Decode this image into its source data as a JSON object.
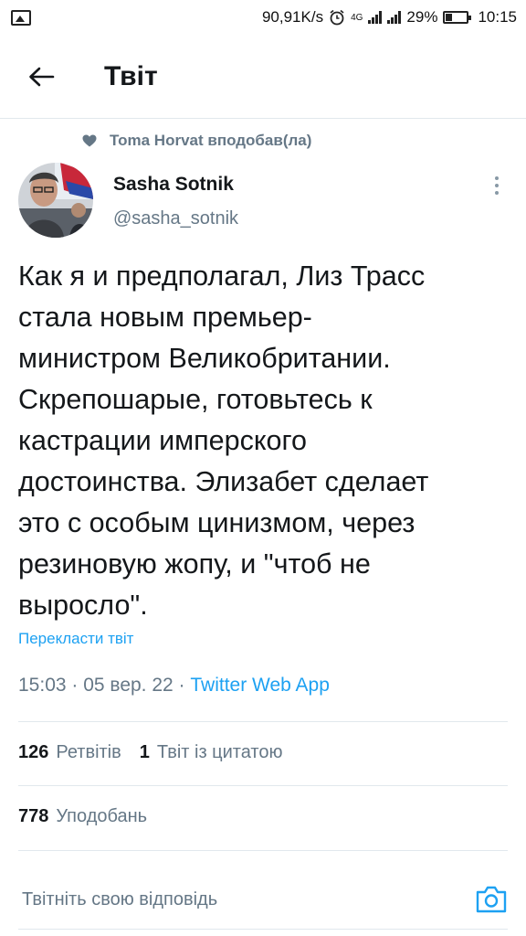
{
  "status_bar": {
    "net_speed": "90,91K/s",
    "net_small": "4G",
    "battery_percent": "29%",
    "battery_level": 0.29,
    "time": "10:15",
    "icons": [
      "image-icon",
      "alarm-icon",
      "signal-icon",
      "signal-icon",
      "battery-icon"
    ]
  },
  "header": {
    "title": "Твіт",
    "back_icon": "arrow-left-icon"
  },
  "tweet": {
    "social_context": "Toma Horvat вподобав(ла)",
    "social_context_icon": "heart-icon",
    "author": {
      "name": "Sasha Sotnik",
      "handle": "@sasha_sotnik"
    },
    "text_lines": [
      "Как я и предполагал, Лиз Трасс",
      "стала новым премьер-",
      "министром Великобритании.",
      "Скрепошарые, готовьтесь к",
      "кастрации имперского",
      "достоинства. Элизабет сделает",
      "это с особым цинизмом, через",
      "резиновую жопу, и \"чтоб не",
      "выросло\"."
    ],
    "translate_label": "Перекласти твіт",
    "timestamp": "15:03 · 05 вер. 22 · ",
    "source": "Twitter Web App",
    "stats": {
      "retweets_count": "126",
      "retweets_label": "Ретвітів",
      "quotes_count": "1",
      "quotes_label": "Твіт із цитатою",
      "likes_count": "778",
      "likes_label": "Уподобань"
    }
  },
  "reply": {
    "placeholder": "Твітніть свою відповідь",
    "camera_icon": "camera-icon"
  },
  "colors": {
    "accent": "#1da1f2",
    "text_primary": "#14171a",
    "text_secondary": "#657786",
    "divider": "#e1e8ed"
  }
}
